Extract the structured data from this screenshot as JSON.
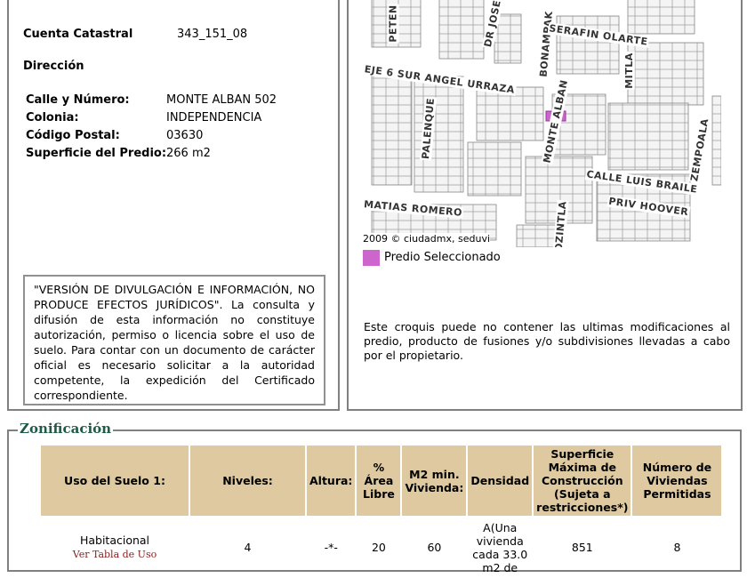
{
  "cuenta": {
    "label": "Cuenta Catastral",
    "value": "343_151_08"
  },
  "direccion": {
    "title": "Dirección",
    "rows": [
      {
        "label": "Calle y Número:",
        "value": "MONTE ALBAN 502"
      },
      {
        "label": "Colonia:",
        "value": "INDEPENDENCIA"
      },
      {
        "label": "Código Postal:",
        "value": "03630"
      },
      {
        "label": "Superficie del Predio:",
        "value": "266 m2"
      }
    ]
  },
  "disclaimer": "\"VERSIÓN DE DIVULGACIÓN E INFORMACIÓN, NO PRODUCE EFECTOS JURÍDICOS\". La consulta y difusión de esta información no constituye autorización, permiso o licencia sobre el uso de suelo. Para contar con un documento de carácter oficial es necesario solicitar a la autoridad competente, la expedición del Certificado correspondiente.",
  "map": {
    "streets": [
      "PETEN",
      "DR JOSE",
      "BONAMPAK",
      "SERAFIN OLARTE",
      "MITLA",
      "EJE 6 SUR ANGEL URRAZA",
      "PALENQUE",
      "MONTE ALBAN",
      "ZEMPOALA",
      "CALLE LUIS BRAILE",
      "PRIV HOOVER",
      "MATIAS ROMERO",
      "OZINTLA"
    ],
    "copyright": "2009 © ciudadmx, seduvi",
    "legend": "Predio Seleccionado",
    "highlight_color": "#cc66cc"
  },
  "map_note": "Este croquis puede no contener las ultimas modificaciones al predio, producto de fusiones y/o subdivisiones llevadas a cabo por el propietario.",
  "zonificacion": {
    "title": "Zonificación",
    "headers": [
      "Uso del Suelo 1:",
      "Niveles:",
      "Altura:",
      "% Área Libre",
      "M2 min. Vivienda:",
      "Densidad",
      "Superficie Máxima de Construcción (Sujeta a restricciones*)",
      "Número de Viviendas Permitidas"
    ],
    "row": {
      "uso": "Habitacional",
      "uso_link": "Ver Tabla de Uso",
      "niveles": "4",
      "altura": "-*-",
      "area_libre": "20",
      "m2_min": "60",
      "densidad": "A(Una vivienda cada 33.0 m2 de",
      "sup_max": "851",
      "viviendas": "8"
    }
  }
}
